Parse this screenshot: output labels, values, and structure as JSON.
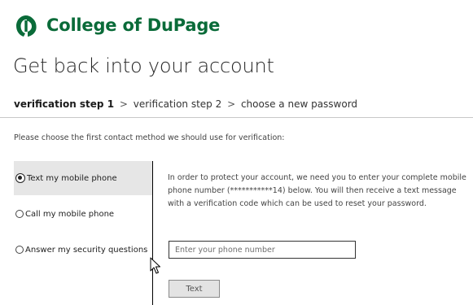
{
  "brand": {
    "name": "College of DuPage",
    "color": "#0a6b39"
  },
  "page": {
    "title": "Get back into your account"
  },
  "breadcrumb": {
    "step1": "verification step 1",
    "step2": "verification step 2",
    "step3": "choose a new password",
    "separator": ">"
  },
  "instruction": "Please choose the first contact method we should use for verification:",
  "methods": [
    {
      "label": "Text my mobile phone",
      "selected": true
    },
    {
      "label": "Call my mobile phone",
      "selected": false
    },
    {
      "label": "Answer my security questions",
      "selected": false
    }
  ],
  "description": "In order to protect your account, we need you to enter your complete mobile phone number (***********14) below. You will then receive a text message with a verification code which can be used to reset your password.",
  "phone_input": {
    "placeholder": "Enter your phone number",
    "value": ""
  },
  "submit_button": {
    "label": "Text"
  },
  "icons": {
    "logo": "college-of-dupage-logo-icon",
    "cursor": "mouse-pointer-icon"
  }
}
